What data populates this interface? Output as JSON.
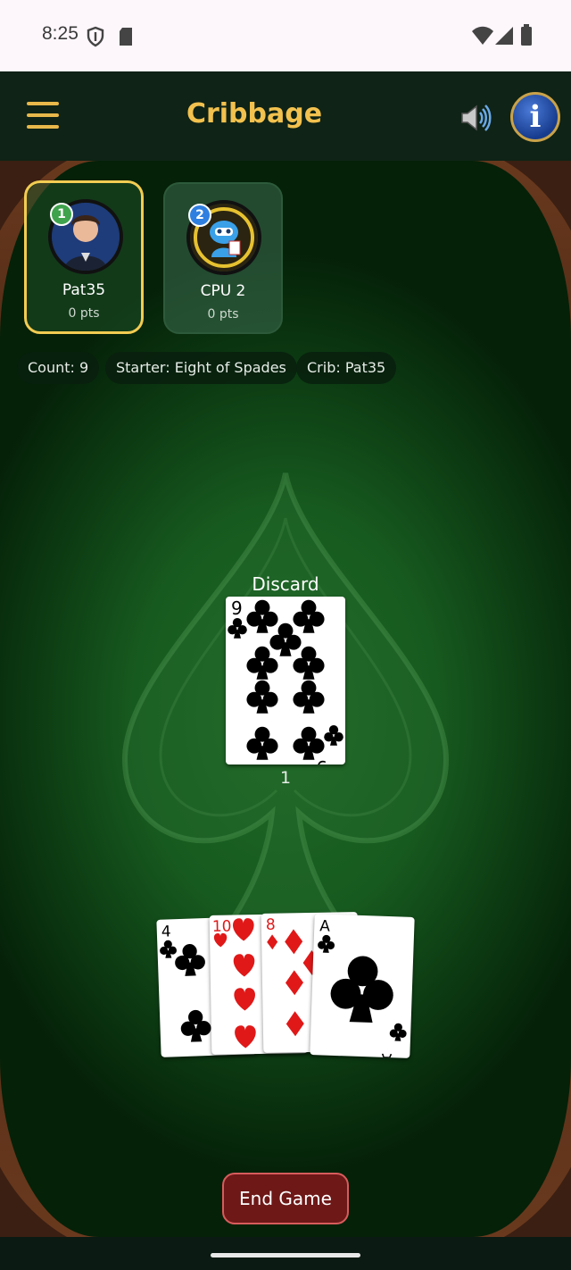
{
  "status_bar": {
    "time": "8:25",
    "icons": [
      "shield-icon",
      "sd-card-icon",
      "wifi-icon",
      "cell-signal-icon",
      "battery-icon"
    ]
  },
  "app_bar": {
    "title": "Cribbage",
    "menu_icon": "hamburger-menu-icon",
    "sound_icon": "speaker-icon",
    "info_label": "i"
  },
  "colors": {
    "accent_gold": "#f2c14e",
    "felt_green": "#175a1f",
    "player1_badge": "#3fa34d",
    "player2_badge": "#2f7fe0",
    "end_button": "#6e1818"
  },
  "players": [
    {
      "number": "1",
      "name": "Pat35",
      "points": "0 pts",
      "active": true
    },
    {
      "number": "2",
      "name": "CPU 2",
      "points": "0 pts",
      "active": false
    }
  ],
  "chips": {
    "count": "Count: 9",
    "starter": "Starter: Eight of Spades",
    "crib": "Crib: Pat35"
  },
  "discard": {
    "label": "Discard",
    "card": {
      "rank": "9",
      "suit": "clubs"
    },
    "pile_count": "1"
  },
  "hand": [
    {
      "rank": "4",
      "suit": "clubs"
    },
    {
      "rank": "10",
      "suit": "hearts"
    },
    {
      "rank": "8",
      "suit": "diamonds"
    },
    {
      "rank": "A",
      "suit": "clubs"
    }
  ],
  "end_game_label": "End Game"
}
